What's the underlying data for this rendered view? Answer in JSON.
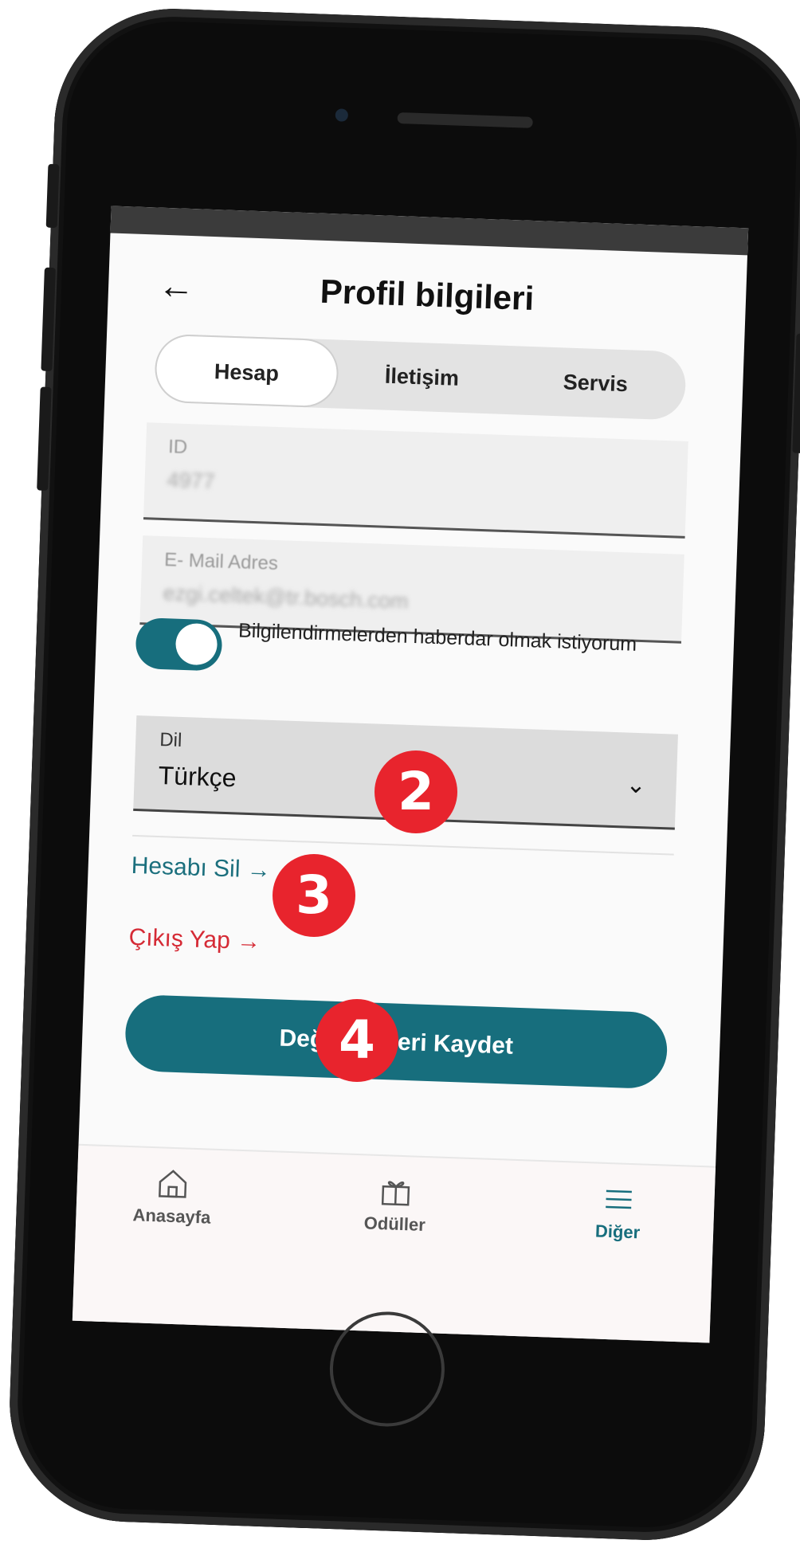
{
  "header": {
    "back_icon": "arrow-left-icon",
    "title": "Profil bilgileri"
  },
  "tabs": [
    {
      "label": "Hesap",
      "active": true
    },
    {
      "label": "İletişim",
      "active": false
    },
    {
      "label": "Servis",
      "active": false
    }
  ],
  "fields": {
    "id": {
      "label": "ID",
      "value": "4977"
    },
    "email": {
      "label": "E- Mail Adres",
      "value": "ezgi.celtek@tr.bosch.com"
    }
  },
  "notifications": {
    "text": "Bilgilendirmelerden haberdar olmak istiyorum",
    "enabled": true
  },
  "language": {
    "label": "Dil",
    "value": "Türkçe"
  },
  "links": {
    "delete_account": "Hesabı Sil →",
    "logout": "Çıkış Yap →"
  },
  "save_button": "Değişiklikleri Kaydet",
  "bottom_nav": [
    {
      "label": "Anasayfa",
      "icon": "home-icon",
      "active": false
    },
    {
      "label": "Odüller",
      "icon": "gift-icon",
      "active": false
    },
    {
      "label": "Diğer",
      "icon": "menu-icon",
      "active": true
    }
  ],
  "annotations": [
    "2",
    "3",
    "4"
  ],
  "colors": {
    "accent": "#176e7d",
    "danger": "#d52a35",
    "badge": "#e8242d"
  }
}
